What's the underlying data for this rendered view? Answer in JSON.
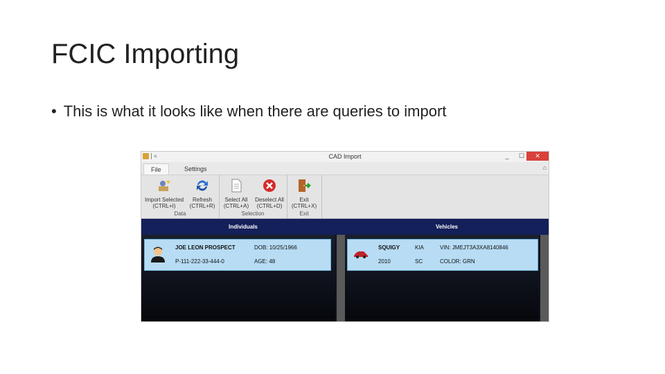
{
  "slide": {
    "title": "FCIC Importing",
    "bullet": "This is what it looks like when there are queries to import"
  },
  "window": {
    "title": "CAD Import",
    "minimize": "_",
    "maximize": "☐",
    "close": "✕",
    "qa_symbol": "="
  },
  "tabs": {
    "file": "File",
    "settings": "Settings",
    "help_icon": "⌂"
  },
  "ribbon": {
    "data_group": {
      "label": "Data",
      "import_selected": {
        "line1": "Import Selected",
        "line2": "(CTRL+I)"
      },
      "refresh": {
        "line1": "Refresh",
        "line2": "(CTRL+R)"
      }
    },
    "selection_group": {
      "label": "Selection",
      "select_all": {
        "line1": "Select All",
        "line2": "(CTRL+A)"
      },
      "deselect_all": {
        "line1": "Deselect All",
        "line2": "(CTRL+D)"
      }
    },
    "exit_group": {
      "label": "Exit",
      "exit": {
        "line1": "Exit",
        "line2": "(CTRL+X)"
      }
    }
  },
  "individuals": {
    "header": "Individuals",
    "record": {
      "name": "JOE LEON PROSPECT",
      "dob": "DOB: 10/25/1966",
      "id": "P-111-222-33-444-0",
      "age": "AGE: 48"
    }
  },
  "vehicles": {
    "header": "Vehicles",
    "record": {
      "model": "SQUIGY",
      "make": "KIA",
      "vin": "VIN: JMEJT3A3XA8140846",
      "year": "2010",
      "state": "SC",
      "color": "COLOR: GRN"
    }
  },
  "colors": {
    "panel_header": "#14205a",
    "card_bg": "#b7dcf4",
    "close_button": "#d9413a"
  }
}
